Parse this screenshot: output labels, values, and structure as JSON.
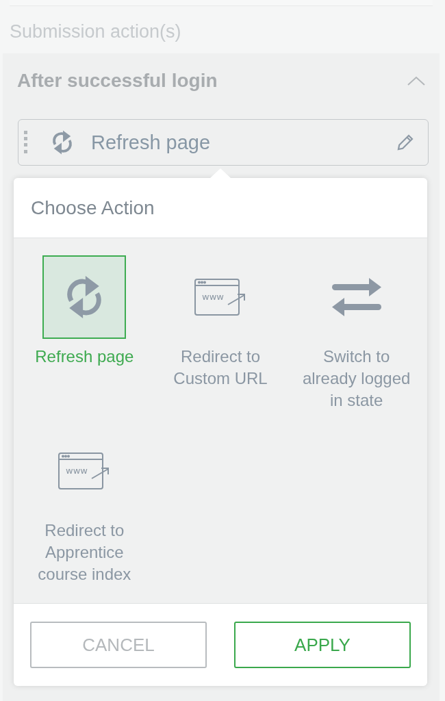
{
  "section_title": "Submission action(s)",
  "panel": {
    "title": "After successful login",
    "expanded": true,
    "action": {
      "kind": "refresh",
      "label": "Refresh page"
    }
  },
  "popover": {
    "title": "Choose Action",
    "options": [
      {
        "kind": "refresh",
        "label": "Refresh page",
        "selected": true
      },
      {
        "kind": "redirect",
        "icon_text": "www",
        "label": "Redirect to Custom URL",
        "selected": false
      },
      {
        "kind": "switch",
        "label": "Switch to already logged in state",
        "selected": false
      },
      {
        "kind": "redirect",
        "icon_text": "www",
        "label": "Redirect to Apprentice course index",
        "selected": false
      }
    ],
    "buttons": [
      {
        "kind": "cancel",
        "label": "CANCEL"
      },
      {
        "kind": "apply",
        "label": "APPLY"
      }
    ]
  }
}
